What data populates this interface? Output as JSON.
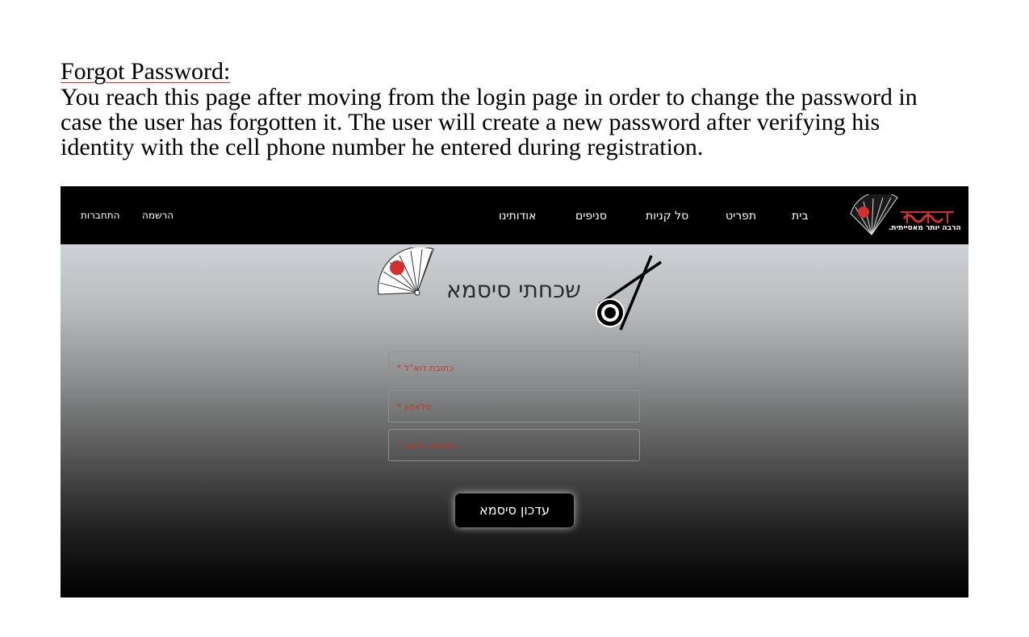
{
  "document": {
    "heading": "Forgot Password:",
    "body": "You reach this page after moving from the login page in order to change the password in case the user has forgotten it. The user will create a new password after verifying his identity with the cell phone number he entered during registration."
  },
  "navbar": {
    "logo_tagline": "הרבה יותר מאסייתית.",
    "links": {
      "home": "בית",
      "menu": "תפריט",
      "cart": "סל קניות",
      "branches": "סניפים",
      "about": "אודותינו"
    },
    "auth": {
      "register": "הרשמה",
      "login": "התחברות"
    }
  },
  "form": {
    "title": "שכחתי סיסמא",
    "fields": {
      "email": "כתובת דוא\"ל *",
      "phone": "פלאפון *",
      "new_password": "סיסמא חדשה *"
    },
    "submit_label": "עדכון סיסמא"
  },
  "colors": {
    "accent_red": "#d32f2f",
    "navbar_bg": "#000000",
    "label_red": "#c0392b"
  },
  "icons": [
    "fan-logo-icon",
    "fan-icon",
    "chopsticks-sushi-icon"
  ]
}
